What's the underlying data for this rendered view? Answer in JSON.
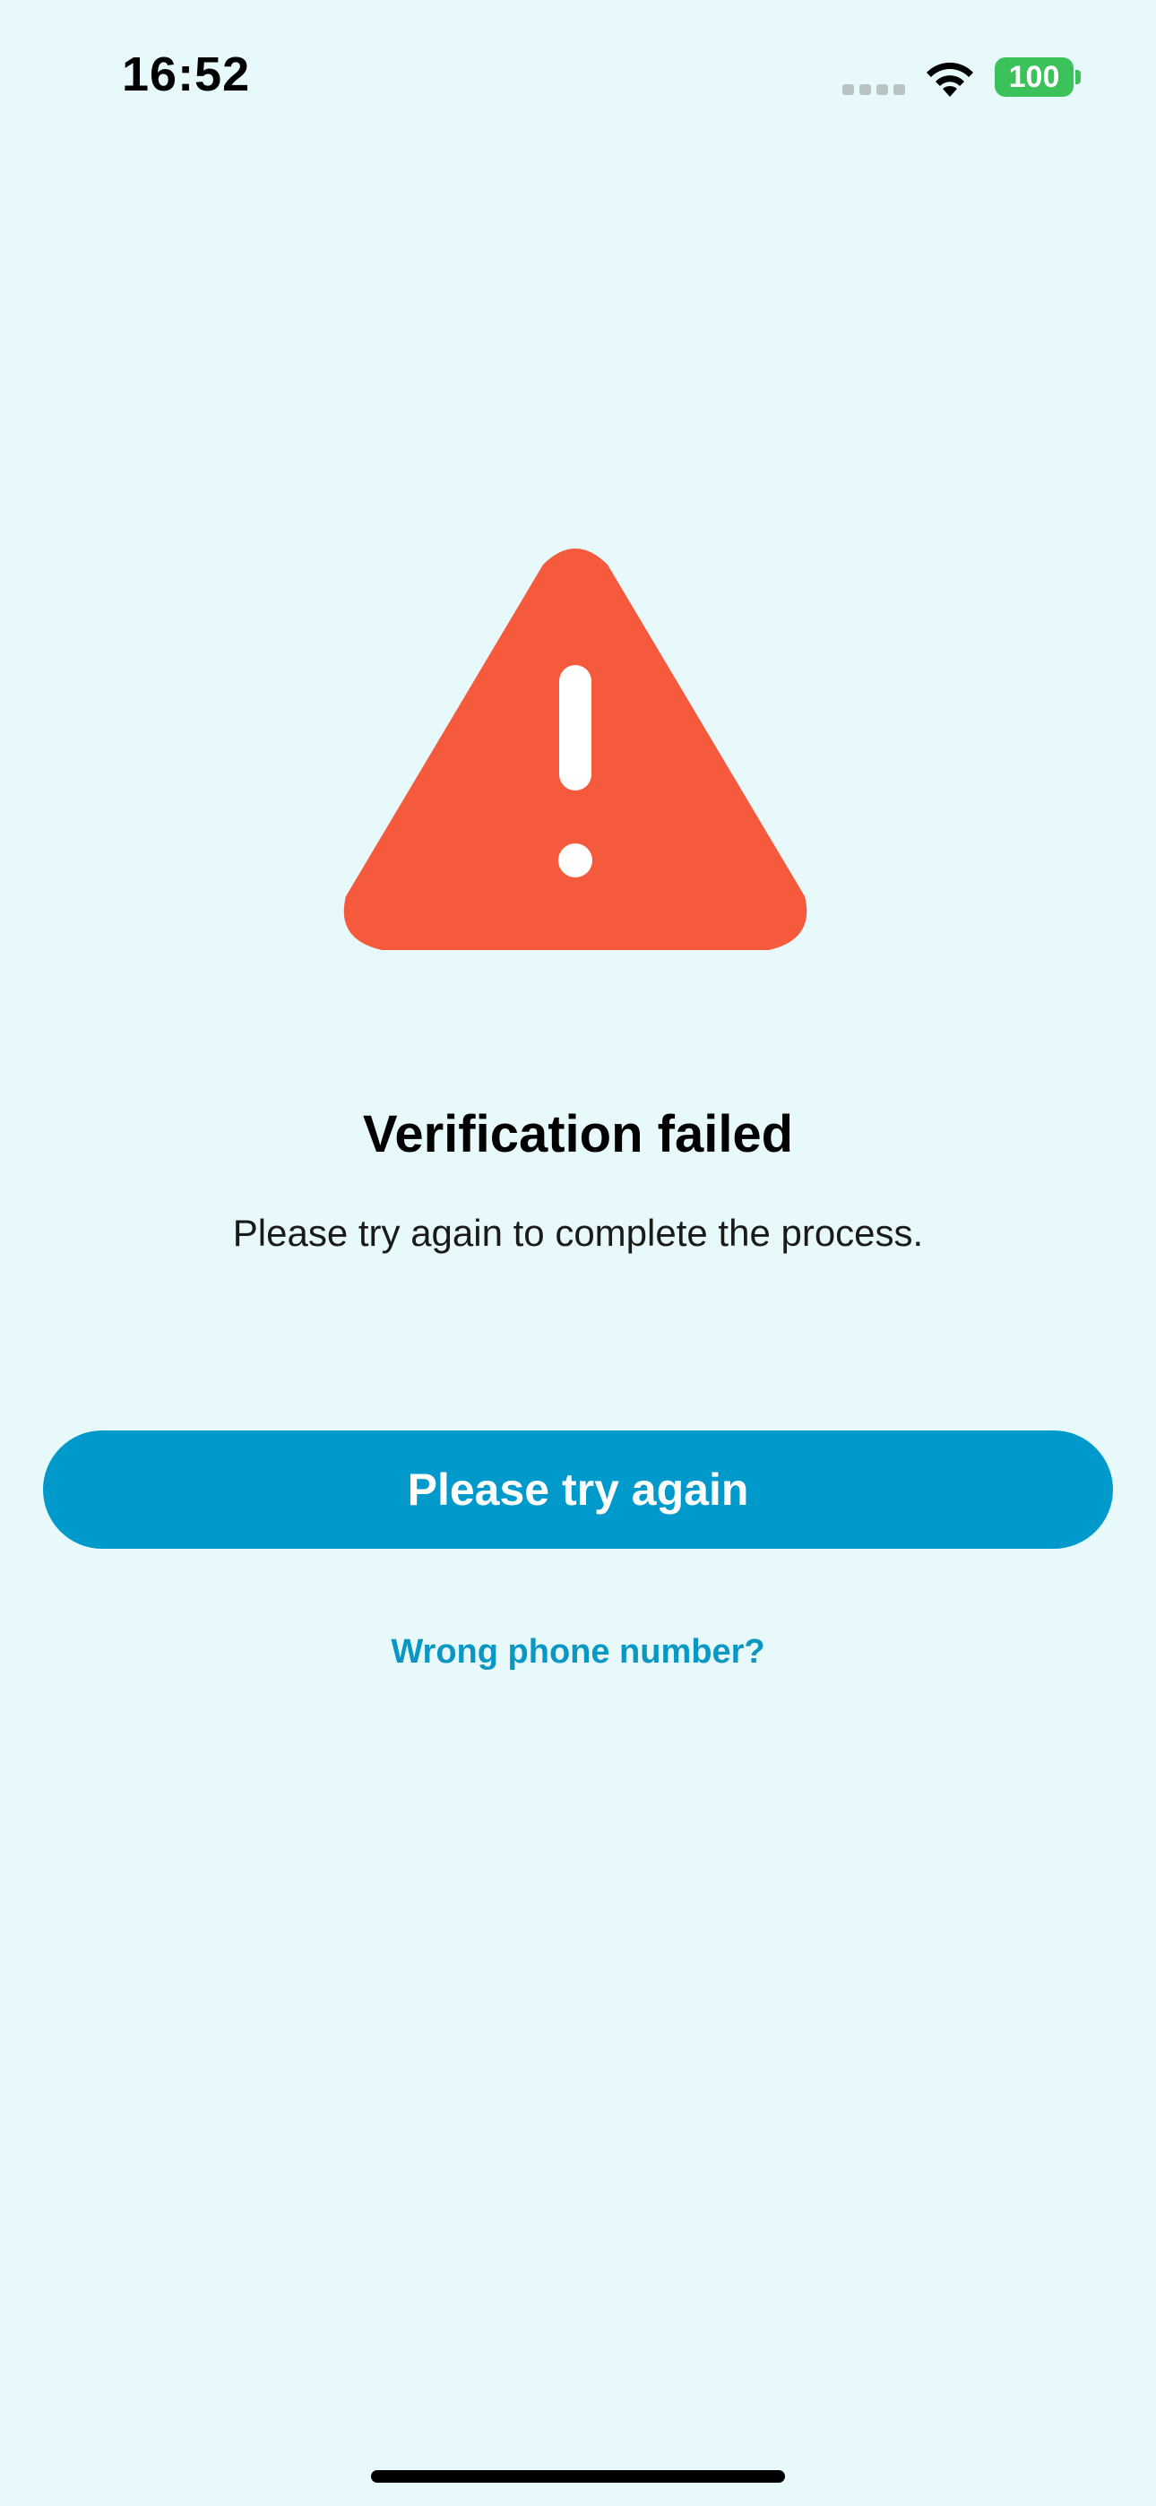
{
  "status_bar": {
    "time": "16:52",
    "battery_level": "100",
    "icons": [
      "signal-dots-icon",
      "wifi-icon",
      "battery-icon"
    ]
  },
  "illustration": {
    "icon": "warning-triangle-icon",
    "color": "#f55a3c"
  },
  "main": {
    "title": "Verification failed",
    "message": "Please try again to complete the process.",
    "primary_button_label": "Please try again",
    "secondary_link_label": "Wrong phone number?"
  },
  "colors": {
    "background": "#e8f9fb",
    "accent": "#0099cc",
    "link": "#0a97c4",
    "warning": "#f55a3c",
    "battery": "#3cc25a"
  }
}
